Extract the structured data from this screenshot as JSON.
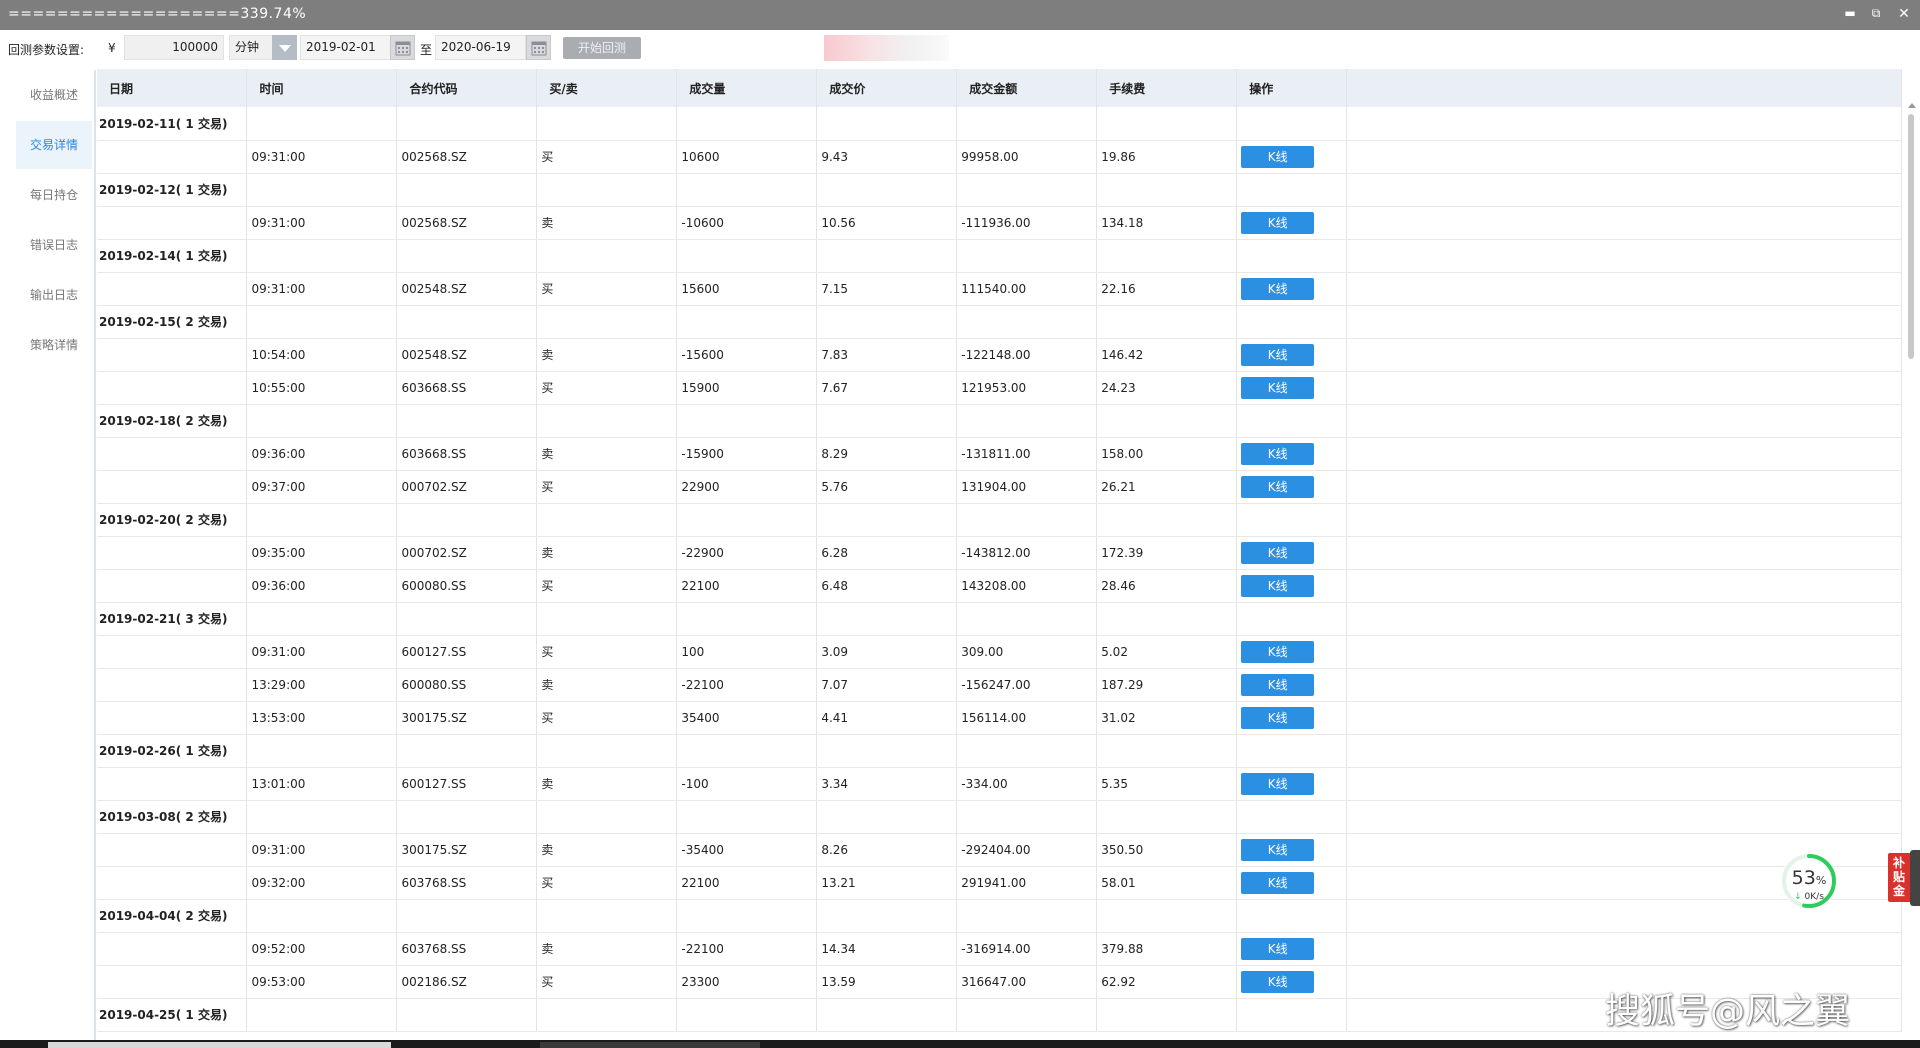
{
  "titlebar": {
    "title": "===================339.74%",
    "minimize_icon": "minimize-icon",
    "restore_icon": "restore-icon",
    "close_icon": "close-icon"
  },
  "params": {
    "label": "回测参数设置:",
    "currency": "¥",
    "capital": "100000",
    "period": "分钟",
    "start_date": "2019-02-01",
    "to_label": "至",
    "end_date": "2020-06-19",
    "start_button": "开始回测"
  },
  "sidebar": {
    "items": [
      {
        "label": "收益概述",
        "active": false
      },
      {
        "label": "交易详情",
        "active": true
      },
      {
        "label": "每日持仓",
        "active": false
      },
      {
        "label": "错误日志",
        "active": false
      },
      {
        "label": "输出日志",
        "active": false
      },
      {
        "label": "策略详情",
        "active": false
      }
    ]
  },
  "table": {
    "headers": [
      "日期",
      "时间",
      "合约代码",
      "买/卖",
      "成交量",
      "成交价",
      "成交金额",
      "手续费",
      "操作"
    ],
    "kline_label": "K线",
    "groups": [
      {
        "date": "2019-02-11( 1 交易)",
        "trades": [
          {
            "time": "09:31:00",
            "code": "002568.SZ",
            "side": "买",
            "volume": "10600",
            "price": "9.43",
            "amount": "99958.00",
            "fee": "19.86"
          }
        ]
      },
      {
        "date": "2019-02-12( 1 交易)",
        "trades": [
          {
            "time": "09:31:00",
            "code": "002568.SZ",
            "side": "卖",
            "volume": "-10600",
            "price": "10.56",
            "amount": "-111936.00",
            "fee": "134.18"
          }
        ]
      },
      {
        "date": "2019-02-14( 1 交易)",
        "trades": [
          {
            "time": "09:31:00",
            "code": "002548.SZ",
            "side": "买",
            "volume": "15600",
            "price": "7.15",
            "amount": "111540.00",
            "fee": "22.16"
          }
        ]
      },
      {
        "date": "2019-02-15( 2 交易)",
        "trades": [
          {
            "time": "10:54:00",
            "code": "002548.SZ",
            "side": "卖",
            "volume": "-15600",
            "price": "7.83",
            "amount": "-122148.00",
            "fee": "146.42"
          },
          {
            "time": "10:55:00",
            "code": "603668.SS",
            "side": "买",
            "volume": "15900",
            "price": "7.67",
            "amount": "121953.00",
            "fee": "24.23"
          }
        ]
      },
      {
        "date": "2019-02-18( 2 交易)",
        "trades": [
          {
            "time": "09:36:00",
            "code": "603668.SS",
            "side": "卖",
            "volume": "-15900",
            "price": "8.29",
            "amount": "-131811.00",
            "fee": "158.00"
          },
          {
            "time": "09:37:00",
            "code": "000702.SZ",
            "side": "买",
            "volume": "22900",
            "price": "5.76",
            "amount": "131904.00",
            "fee": "26.21"
          }
        ]
      },
      {
        "date": "2019-02-20( 2 交易)",
        "trades": [
          {
            "time": "09:35:00",
            "code": "000702.SZ",
            "side": "卖",
            "volume": "-22900",
            "price": "6.28",
            "amount": "-143812.00",
            "fee": "172.39"
          },
          {
            "time": "09:36:00",
            "code": "600080.SS",
            "side": "买",
            "volume": "22100",
            "price": "6.48",
            "amount": "143208.00",
            "fee": "28.46"
          }
        ]
      },
      {
        "date": "2019-02-21( 3 交易)",
        "trades": [
          {
            "time": "09:31:00",
            "code": "600127.SS",
            "side": "买",
            "volume": "100",
            "price": "3.09",
            "amount": "309.00",
            "fee": "5.02"
          },
          {
            "time": "13:29:00",
            "code": "600080.SS",
            "side": "卖",
            "volume": "-22100",
            "price": "7.07",
            "amount": "-156247.00",
            "fee": "187.29"
          },
          {
            "time": "13:53:00",
            "code": "300175.SZ",
            "side": "买",
            "volume": "35400",
            "price": "4.41",
            "amount": "156114.00",
            "fee": "31.02"
          }
        ]
      },
      {
        "date": "2019-02-26( 1 交易)",
        "trades": [
          {
            "time": "13:01:00",
            "code": "600127.SS",
            "side": "卖",
            "volume": "-100",
            "price": "3.34",
            "amount": "-334.00",
            "fee": "5.35"
          }
        ]
      },
      {
        "date": "2019-03-08( 2 交易)",
        "trades": [
          {
            "time": "09:31:00",
            "code": "300175.SZ",
            "side": "卖",
            "volume": "-35400",
            "price": "8.26",
            "amount": "-292404.00",
            "fee": "350.50"
          },
          {
            "time": "09:32:00",
            "code": "603768.SS",
            "side": "买",
            "volume": "22100",
            "price": "13.21",
            "amount": "291941.00",
            "fee": "58.01"
          }
        ]
      },
      {
        "date": "2019-04-04( 2 交易)",
        "trades": [
          {
            "time": "09:52:00",
            "code": "603768.SS",
            "side": "卖",
            "volume": "-22100",
            "price": "14.34",
            "amount": "-316914.00",
            "fee": "379.88"
          },
          {
            "time": "09:53:00",
            "code": "002186.SZ",
            "side": "买",
            "volume": "23300",
            "price": "13.59",
            "amount": "316647.00",
            "fee": "62.92"
          }
        ]
      },
      {
        "date": "2019-04-25( 1 交易)",
        "trades": []
      }
    ]
  },
  "overlay": {
    "gauge_percent": "53",
    "gauge_percent_unit": "%",
    "gauge_speed": "0K/s",
    "gauge_fraction": 0.53,
    "subsidy_label": "补贴金",
    "watermark": "搜狐号@风之翼"
  },
  "colors": {
    "accent": "#2b8fe2",
    "titlebar": "#7e7e7e",
    "header_bg": "#e9eff5",
    "gauge_green": "#2ecc5a",
    "subsidy_red": "#d9312b"
  }
}
